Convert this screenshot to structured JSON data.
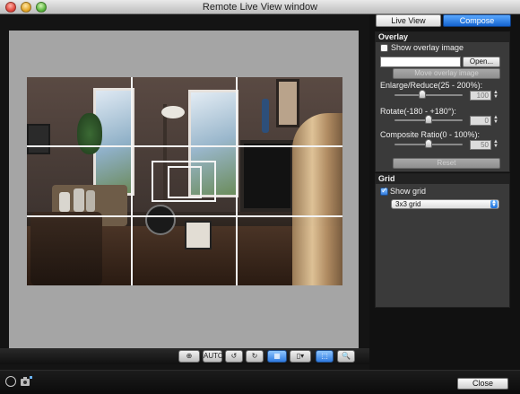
{
  "window": {
    "title": "Remote Live View window"
  },
  "tabs": [
    {
      "label": "Live View",
      "active": false
    },
    {
      "label": "Compose",
      "active": true
    }
  ],
  "overlay": {
    "header": "Overlay",
    "show_overlay_label": "Show overlay image",
    "show_overlay_checked": false,
    "file_path_value": "",
    "open_label": "Open...",
    "move_overlay_label": "Move overlay image",
    "enlarge_label": "Enlarge/Reduce(25 - 200%):",
    "enlarge_value": "100",
    "rotate_label": "Rotate(-180 - +180°):",
    "rotate_value": "0",
    "composite_label": "Composite Ratio(0 - 100%):",
    "composite_value": "50",
    "reset_label": "Reset"
  },
  "grid": {
    "header": "Grid",
    "show_grid_label": "Show grid",
    "show_grid_checked": true,
    "grid_type_selected": "3x3 grid"
  },
  "toolbar": {
    "buttons": [
      {
        "icon": "crosshair-icon"
      },
      {
        "icon": "auto-focus-icon",
        "label": "AUTO"
      },
      {
        "icon": "rotate-left-icon"
      },
      {
        "icon": "rotate-right-icon"
      },
      {
        "icon": "grid-toggle-icon",
        "active": true
      },
      {
        "icon": "aspect-ratio-icon"
      },
      {
        "icon": "zoom-frame-icon",
        "active": true
      },
      {
        "icon": "magnify-icon"
      }
    ]
  },
  "bottom": {
    "close_label": "Close"
  }
}
